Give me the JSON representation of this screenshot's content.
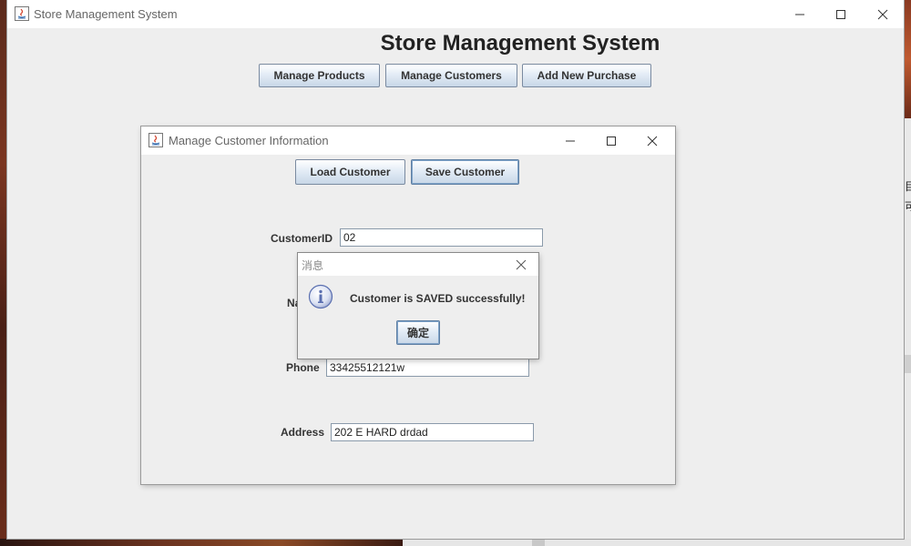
{
  "main_window": {
    "title": "Store Management System",
    "heading": "Store Management System",
    "nav_buttons": [
      "Manage Products",
      "Manage Customers",
      "Add New Purchase"
    ]
  },
  "customer_window": {
    "title": "Manage Customer Information",
    "buttons": {
      "load": "Load Customer",
      "save": "Save Customer"
    },
    "fields": {
      "customer_id": {
        "label": "CustomerID",
        "value": "02"
      },
      "name": {
        "label": "Na",
        "value": ""
      },
      "phone": {
        "label": "Phone",
        "value": "33425512121w"
      },
      "address": {
        "label": "Address",
        "value": "202 E HARD drdad"
      }
    }
  },
  "dialog": {
    "title": "消息",
    "message": "Customer is SAVED successfully!",
    "ok_label": "确定",
    "icon": "info-icon"
  },
  "background_fragments": {
    "right_char_1": "目",
    "right_char_2": "可"
  },
  "colors": {
    "button_gradient_end": "#c8d7e7",
    "frame_bg": "#eeeeee",
    "info_icon": "#5a6fb0"
  }
}
